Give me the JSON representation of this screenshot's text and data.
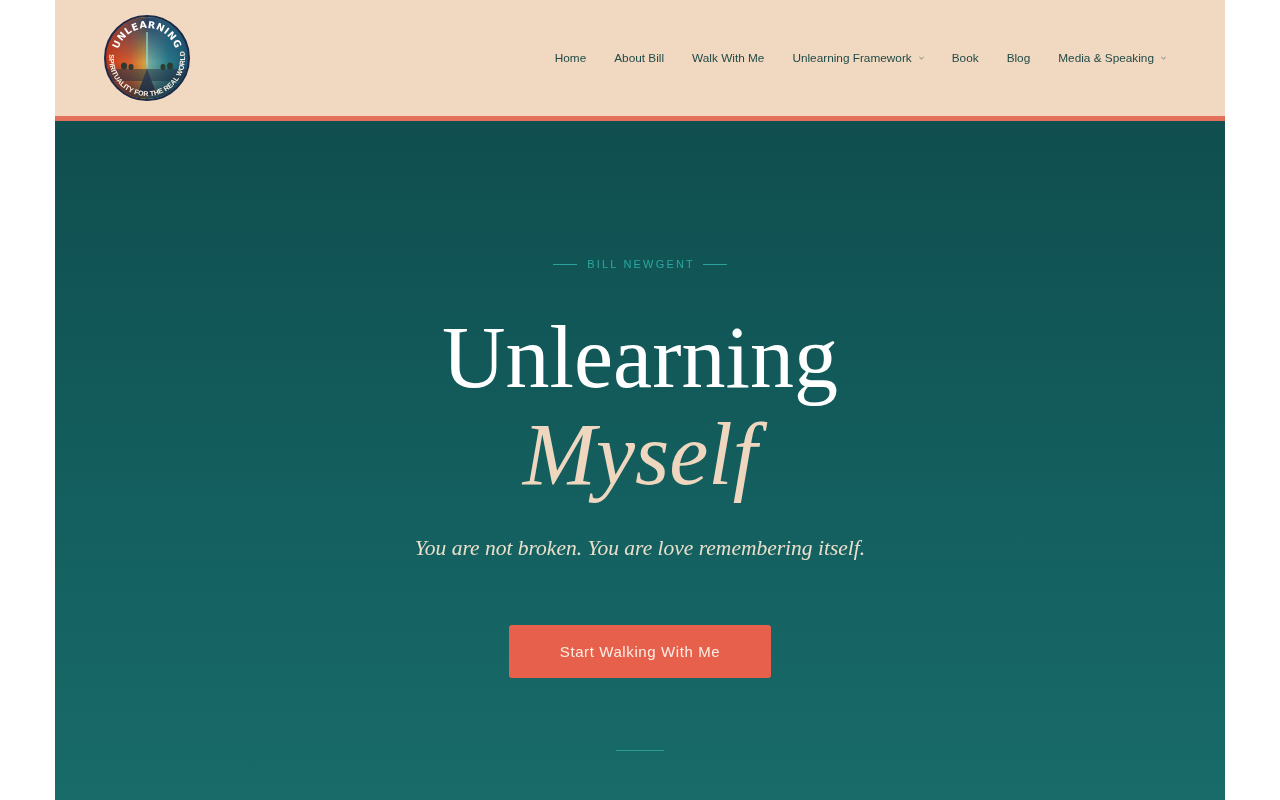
{
  "header": {
    "logo": {
      "title": "UNLEARNING",
      "tagline": "SPIRITUALITY FOR THE REAL WORLD"
    },
    "nav": [
      {
        "label": "Home",
        "has_dropdown": false
      },
      {
        "label": "About Bill",
        "has_dropdown": false
      },
      {
        "label": "Walk With Me",
        "has_dropdown": false
      },
      {
        "label": "Unlearning Framework",
        "has_dropdown": true
      },
      {
        "label": "Book",
        "has_dropdown": false
      },
      {
        "label": "Blog",
        "has_dropdown": false
      },
      {
        "label": "Media & Speaking",
        "has_dropdown": true
      }
    ]
  },
  "hero": {
    "eyebrow": "BILL NEWGENT",
    "title": "Unlearning",
    "title_accent": "Myself",
    "subtitle": "You are not broken. You are love remembering itself.",
    "cta": "Start Walking With Me"
  }
}
